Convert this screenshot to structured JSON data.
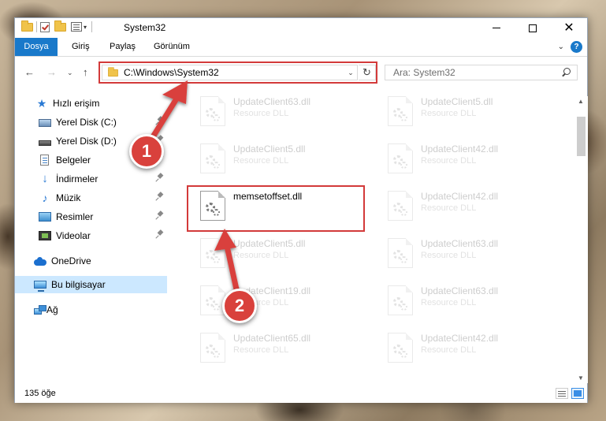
{
  "window": {
    "title": "System32"
  },
  "ribbon": {
    "tabs": [
      "Dosya",
      "Giriş",
      "Paylaş",
      "Görünüm"
    ]
  },
  "address": {
    "path": "C:\\Windows\\System32"
  },
  "search": {
    "placeholder": "Ara: System32"
  },
  "sidebar": {
    "items": [
      {
        "label": "Hızlı erişim",
        "icon": "star-icon"
      },
      {
        "label": "Yerel Disk (C:)",
        "icon": "disk-icon",
        "pinned": true
      },
      {
        "label": "Yerel Disk (D:)",
        "icon": "disk-icon",
        "pinned": true
      },
      {
        "label": "Belgeler",
        "icon": "document-icon",
        "pinned": true
      },
      {
        "label": "İndirmeler",
        "icon": "download-icon",
        "pinned": true
      },
      {
        "label": "Müzik",
        "icon": "music-icon",
        "pinned": true
      },
      {
        "label": "Resimler",
        "icon": "pictures-icon",
        "pinned": true
      },
      {
        "label": "Videolar",
        "icon": "video-icon",
        "pinned": true
      },
      {
        "label": "OneDrive",
        "icon": "cloud-icon"
      },
      {
        "label": "Bu bilgisayar",
        "icon": "computer-icon",
        "selected": true
      },
      {
        "label": "Ağ",
        "icon": "network-icon"
      }
    ]
  },
  "files": [
    {
      "name": "UpdateClient63.dll",
      "desc": "Resource DLL",
      "faded": true
    },
    {
      "name": "UpdateClient5.dll",
      "desc": "Resource DLL",
      "faded": true
    },
    {
      "name": "UpdateClient5.dll",
      "desc": "Resource DLL",
      "faded": true
    },
    {
      "name": "UpdateClient42.dll",
      "desc": "Resource DLL",
      "faded": true
    },
    {
      "name": "memsetoffset.dll",
      "desc": "",
      "faded": false
    },
    {
      "name": "UpdateClient42.dll",
      "desc": "Resource DLL",
      "faded": true
    },
    {
      "name": "UpdateClient5.dll",
      "desc": "Resource DLL",
      "faded": true
    },
    {
      "name": "UpdateClient63.dll",
      "desc": "Resource DLL",
      "faded": true
    },
    {
      "name": "UpdateClient19.dll",
      "desc": "Resource DLL",
      "faded": true
    },
    {
      "name": "UpdateClient63.dll",
      "desc": "Resource DLL",
      "faded": true
    },
    {
      "name": "UpdateClient65.dll",
      "desc": "Resource DLL",
      "faded": true
    },
    {
      "name": "UpdateClient42.dll",
      "desc": "Resource DLL",
      "faded": true
    }
  ],
  "status": {
    "count": "135 öğe"
  },
  "annotations": {
    "badge1": "1",
    "badge2": "2"
  },
  "colors": {
    "accent": "#1979ca",
    "highlight": "#d33a3a",
    "badge": "#d9413c",
    "selected": "#cce8ff"
  }
}
